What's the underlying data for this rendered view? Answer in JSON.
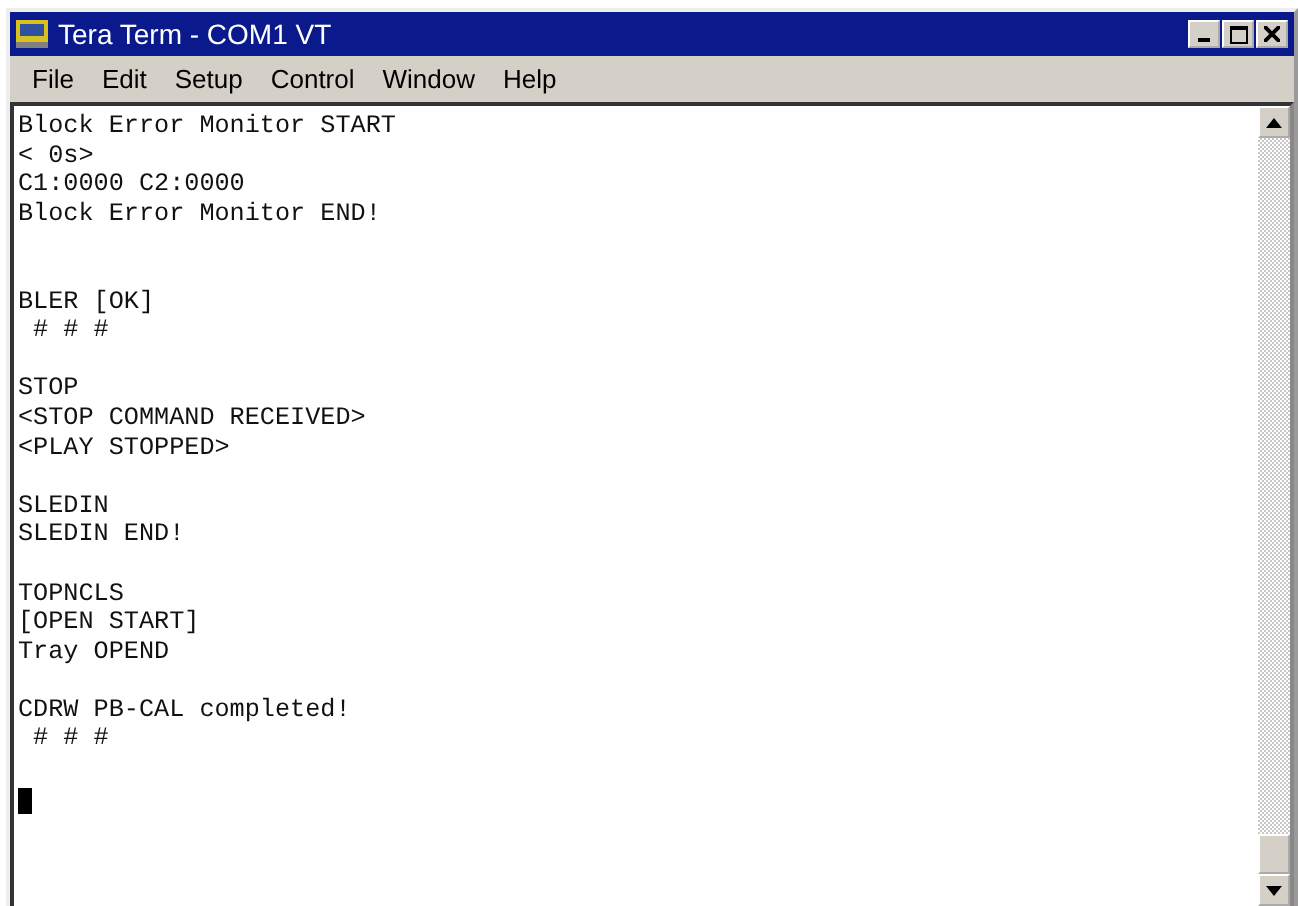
{
  "window": {
    "title": "Tera Term - COM1 VT"
  },
  "menu": [
    "File",
    "Edit",
    "Setup",
    "Control",
    "Window",
    "Help"
  ],
  "terminal": {
    "cursor": true,
    "blocks": [
      {
        "lines": [
          "Block Error Monitor START",
          "< 0s>",
          "C1:0000 C2:0000",
          "Block Error Monitor END!"
        ]
      },
      {
        "lines": [
          "BLER [OK]",
          " # # #"
        ]
      },
      {
        "lines": [
          "STOP",
          "<STOP COMMAND RECEIVED>",
          "<PLAY STOPPED>"
        ]
      },
      {
        "lines": [
          "SLEDIN",
          "SLEDIN END!"
        ]
      },
      {
        "lines": [
          "TOPNCLS",
          "[OPEN START]",
          "Tray OPEND"
        ]
      },
      {
        "lines": [
          "CDRW PB-CAL completed!",
          " # # #"
        ]
      }
    ]
  }
}
